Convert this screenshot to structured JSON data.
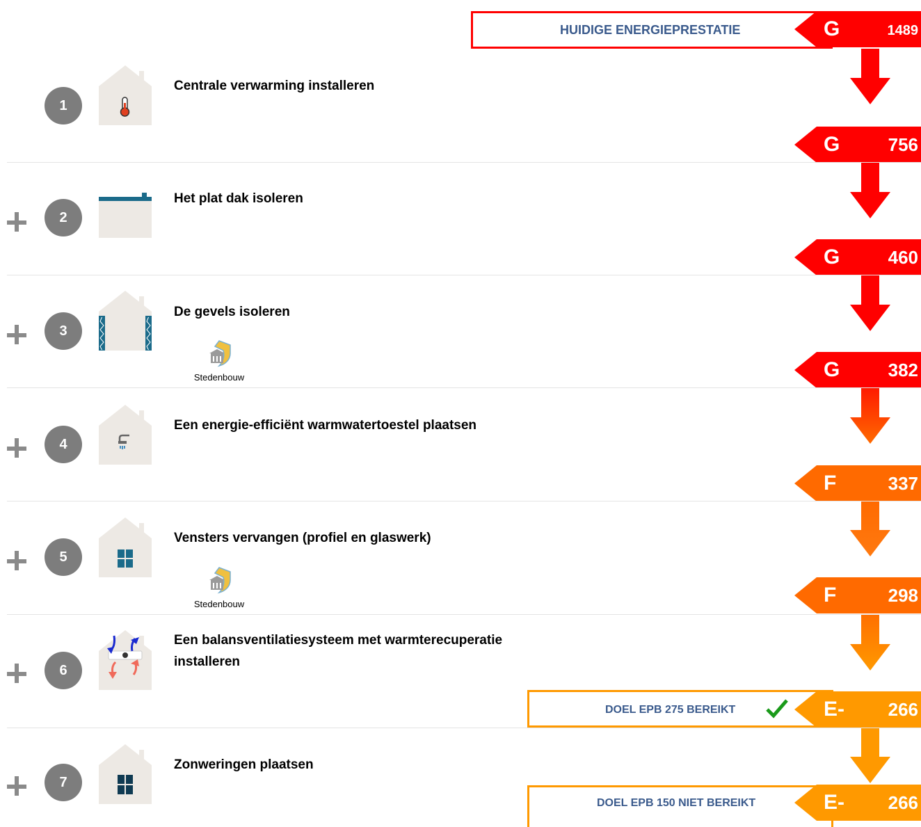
{
  "current": {
    "label": "HUIDIGE ENERGIEPRESTATIE",
    "letter": "G",
    "value": "1489",
    "color": "#ff0000"
  },
  "steps": [
    {
      "number": "1",
      "title": "Centrale verwarming installeren",
      "icon": "thermometer-icon",
      "plus": false,
      "result": {
        "letter": "G",
        "value": "756",
        "color": "#ff0000"
      }
    },
    {
      "number": "2",
      "title": "Het plat dak isoleren",
      "icon": "flat-roof-icon",
      "plus": true,
      "result": {
        "letter": "G",
        "value": "460",
        "color": "#ff0000"
      }
    },
    {
      "number": "3",
      "title": "De gevels isoleren",
      "icon": "wall-insulation-icon",
      "plus": true,
      "permit": "Stedenbouw",
      "result": {
        "letter": "G",
        "value": "382",
        "color": "#ff0000"
      }
    },
    {
      "number": "4",
      "title": "Een energie-efficiënt warmwatertoestel plaatsen",
      "icon": "water-heater-icon",
      "plus": true,
      "result": {
        "letter": "F",
        "value": "337",
        "color": "#ff6a00"
      }
    },
    {
      "number": "5",
      "title": "Vensters vervangen (profiel en glaswerk)",
      "icon": "window-icon",
      "plus": true,
      "permit": "Stedenbouw",
      "result": {
        "letter": "F",
        "value": "298",
        "color": "#ff6a00"
      }
    },
    {
      "number": "6",
      "title_line1": "Een balansventilatiesysteem met warmterecuperatie",
      "title_line2": "installeren",
      "icon": "ventilation-icon",
      "plus": true,
      "result": {
        "letter": "E-",
        "value": "266",
        "color": "#ff9900",
        "goal": "DOEL EPB 275 BEREIKT",
        "goal_reached": true
      }
    },
    {
      "number": "7",
      "title": "Zonweringen plaatsen",
      "icon": "sunshade-window-icon",
      "plus": true,
      "result": {
        "letter": "E-",
        "value": "266",
        "color": "#ff9900",
        "goal": "DOEL EPB 150 NIET BEREIKT",
        "goal_reached": false
      }
    }
  ],
  "colors": {
    "red": "#ff0000",
    "orange_red": "#ff6a00",
    "orange": "#ff9900",
    "label_blue": "#3a5a8c",
    "circle_gray": "#7d7d7d",
    "house_beige": "#ede9e4",
    "accent_teal": "#1b6b8a",
    "check_green": "#1a9a1a"
  }
}
